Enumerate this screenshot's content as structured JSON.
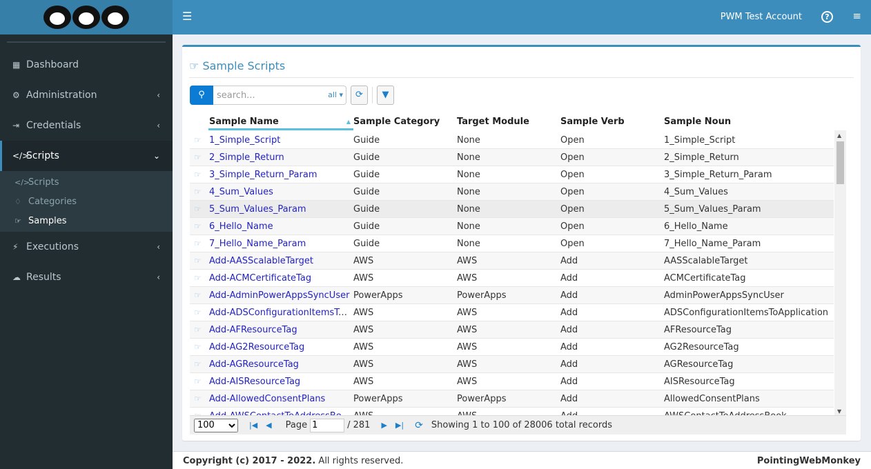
{
  "header": {
    "account": "PWM Test Account",
    "menu_icon": "hamburger-icon",
    "help_icon": "question-circle-icon",
    "settings_icon": "sliders-icon"
  },
  "sidebar": {
    "items": [
      {
        "label": "Dashboard",
        "icon": "grid-icon"
      },
      {
        "label": "Administration",
        "icon": "gears-icon"
      },
      {
        "label": "Credentials",
        "icon": "sign-in-icon"
      },
      {
        "label": "Scripts",
        "icon": "code-icon"
      },
      {
        "label": "Executions",
        "icon": "bolt-icon"
      },
      {
        "label": "Results",
        "icon": "cloud-download-icon"
      }
    ],
    "sub": [
      {
        "label": "Scripts"
      },
      {
        "label": "Categories"
      },
      {
        "label": "Samples"
      }
    ]
  },
  "page": {
    "title": "Sample Scripts",
    "search_placeholder": "search...",
    "scope": "all"
  },
  "table": {
    "columns": [
      "Sample Name",
      "Sample Category",
      "Target Module",
      "Sample Verb",
      "Sample Noun"
    ],
    "rows": [
      [
        "1_Simple_Script",
        "Guide",
        "None",
        "Open",
        "1_Simple_Script"
      ],
      [
        "2_Simple_Return",
        "Guide",
        "None",
        "Open",
        "2_Simple_Return"
      ],
      [
        "3_Simple_Return_Param",
        "Guide",
        "None",
        "Open",
        "3_Simple_Return_Param"
      ],
      [
        "4_Sum_Values",
        "Guide",
        "None",
        "Open",
        "4_Sum_Values"
      ],
      [
        "5_Sum_Values_Param",
        "Guide",
        "None",
        "Open",
        "5_Sum_Values_Param"
      ],
      [
        "6_Hello_Name",
        "Guide",
        "None",
        "Open",
        "6_Hello_Name"
      ],
      [
        "7_Hello_Name_Param",
        "Guide",
        "None",
        "Open",
        "7_Hello_Name_Param"
      ],
      [
        "Add-AASScalableTarget",
        "AWS",
        "AWS",
        "Add",
        "AASScalableTarget"
      ],
      [
        "Add-ACMCertificateTag",
        "AWS",
        "AWS",
        "Add",
        "ACMCertificateTag"
      ],
      [
        "Add-AdminPowerAppsSyncUser",
        "PowerApps",
        "PowerApps",
        "Add",
        "AdminPowerAppsSyncUser"
      ],
      [
        "Add-ADSConfigurationItemsToApplication",
        "AWS",
        "AWS",
        "Add",
        "ADSConfigurationItemsToApplication"
      ],
      [
        "Add-AFResourceTag",
        "AWS",
        "AWS",
        "Add",
        "AFResourceTag"
      ],
      [
        "Add-AG2ResourceTag",
        "AWS",
        "AWS",
        "Add",
        "AG2ResourceTag"
      ],
      [
        "Add-AGResourceTag",
        "AWS",
        "AWS",
        "Add",
        "AGResourceTag"
      ],
      [
        "Add-AISResourceTag",
        "AWS",
        "AWS",
        "Add",
        "AISResourceTag"
      ],
      [
        "Add-AllowedConsentPlans",
        "PowerApps",
        "PowerApps",
        "Add",
        "AllowedConsentPlans"
      ],
      [
        "Add-AWSContactToAddressBook",
        "AWS",
        "AWS",
        "Add",
        "AWSContactToAddressBook"
      ]
    ]
  },
  "pager": {
    "page_size": "100",
    "page_label": "Page",
    "page": "1",
    "total_pages": "/ 281",
    "status": "Showing 1 to 100 of 28006 total records"
  },
  "footer": {
    "copyright_bold": "Copyright (c) 2017 - 2022.",
    "copyright_rest": " All rights reserved.",
    "brand": "PointingWebMonkey"
  },
  "colors": {
    "header": "#3c8dbc",
    "sidebar": "#222d32",
    "link": "#2323c0"
  }
}
